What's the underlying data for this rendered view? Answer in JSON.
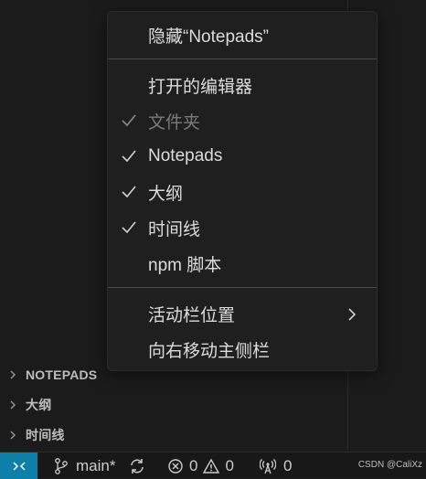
{
  "context_menu": {
    "items": [
      {
        "label": "隐藏“Notepads”",
        "checked": false,
        "enabled": true
      },
      {
        "label": "打开的编辑器",
        "checked": false,
        "enabled": true
      },
      {
        "label": "文件夹",
        "checked": true,
        "enabled": false
      },
      {
        "label": "Notepads",
        "checked": true,
        "enabled": true
      },
      {
        "label": "大纲",
        "checked": true,
        "enabled": true
      },
      {
        "label": "时间线",
        "checked": true,
        "enabled": true
      },
      {
        "label": "npm 脚本",
        "checked": false,
        "enabled": true
      },
      {
        "label": "活动栏位置",
        "checked": false,
        "enabled": true,
        "submenu": true
      },
      {
        "label": "向右移动主侧栏",
        "checked": false,
        "enabled": true
      }
    ]
  },
  "side_panel": {
    "sections": [
      {
        "label": "NOTEPADS",
        "icon": "chevron-right-icon"
      },
      {
        "label": "大纲",
        "icon": "chevron-right-icon"
      },
      {
        "label": "时间线",
        "icon": "chevron-right-icon"
      }
    ]
  },
  "status_bar": {
    "remote_icon": "remote-icon",
    "branch": "main*",
    "errors": "0",
    "warnings": "0",
    "ports": "0",
    "watermark": "CSDN @CaliXz"
  },
  "colors": {
    "remote_bg": "#0e7fa8",
    "menu_bg": "#1f1f1f",
    "background": "#1b1b1b"
  }
}
